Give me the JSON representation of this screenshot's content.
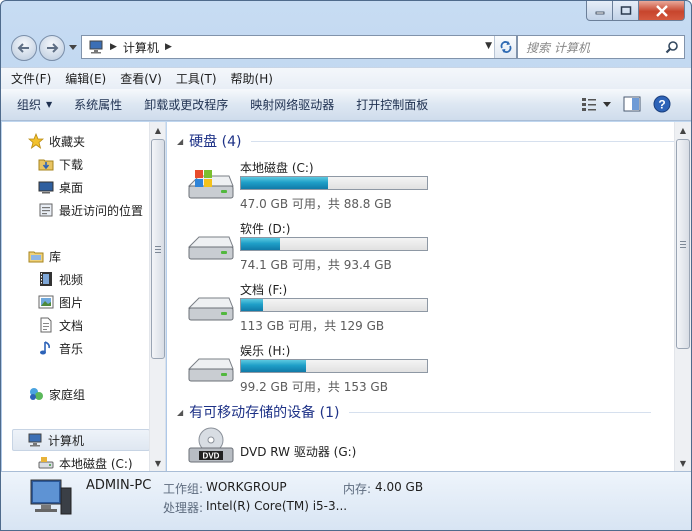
{
  "window": {
    "title": "计算机"
  },
  "address": {
    "path": "计算机",
    "search_placeholder": "搜索 计算机"
  },
  "menu": [
    "文件(F)",
    "编辑(E)",
    "查看(V)",
    "工具(T)",
    "帮助(H)"
  ],
  "toolbar": {
    "organize": "组织",
    "system_properties": "系统属性",
    "uninstall": "卸载或更改程序",
    "map_drive": "映射网络驱动器",
    "control_panel": "打开控制面板"
  },
  "nav": {
    "favorites": "收藏夹",
    "downloads": "下载",
    "desktop": "桌面",
    "recent": "最近访问的位置",
    "libraries": "库",
    "videos": "视频",
    "pictures": "图片",
    "documents": "文档",
    "music": "音乐",
    "homegroup": "家庭组",
    "computer": "计算机",
    "local_disk": "本地磁盘 (C:)"
  },
  "groups": {
    "hard_disks": "硬盘 (4)",
    "removable": "有可移动存储的设备 (1)"
  },
  "drives": [
    {
      "name": "本地磁盘 (C:)",
      "info": "47.0 GB 可用，共 88.8 GB",
      "used_fraction": 0.47
    },
    {
      "name": "软件 (D:)",
      "info": "74.1 GB 可用，共 93.4 GB",
      "used_fraction": 0.21
    },
    {
      "name": "文档 (F:)",
      "info": "113 GB 可用，共 129 GB",
      "used_fraction": 0.12
    },
    {
      "name": "娱乐 (H:)",
      "info": "99.2 GB 可用，共 153 GB",
      "used_fraction": 0.35
    }
  ],
  "dvd": {
    "name": "DVD RW 驱动器 (G:)",
    "label": "DVD"
  },
  "details": {
    "pc_name": "ADMIN-PC",
    "workgroup_label": "工作组:",
    "workgroup": "WORKGROUP",
    "memory_label": "内存:",
    "memory": "4.00 GB",
    "cpu_label": "处理器:",
    "cpu": "Intel(R) Core(TM) i5-3..."
  },
  "colors": {
    "bar_fill": "#1f9fc8",
    "group_title": "#1e3287",
    "close_red": "#c7452d"
  }
}
